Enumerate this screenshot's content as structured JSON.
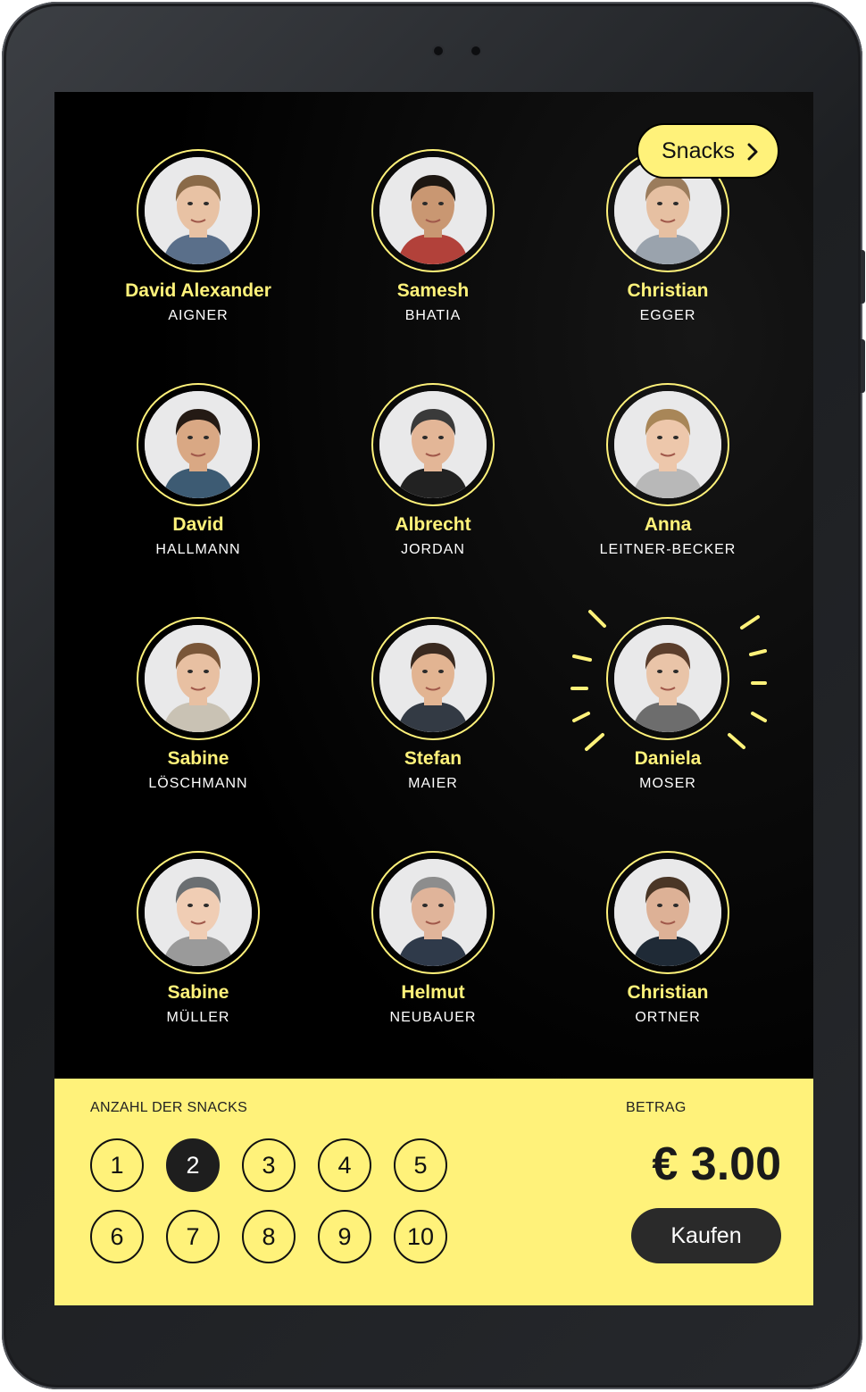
{
  "header": {
    "snacks_button_label": "Snacks"
  },
  "people": [
    {
      "first": "David Alexander",
      "last": "AIGNER",
      "selected": false
    },
    {
      "first": "Samesh",
      "last": "BHATIA",
      "selected": false
    },
    {
      "first": "Christian",
      "last": "EGGER",
      "selected": false
    },
    {
      "first": "David",
      "last": "HALLMANN",
      "selected": false
    },
    {
      "first": "Albrecht",
      "last": "JORDAN",
      "selected": false
    },
    {
      "first": "Anna",
      "last": "LEITNER-BECKER",
      "selected": false
    },
    {
      "first": "Sabine",
      "last": "LÖSCHMANN",
      "selected": false
    },
    {
      "first": "Stefan",
      "last": "MAIER",
      "selected": false
    },
    {
      "first": "Daniela",
      "last": "MOSER",
      "selected": true
    },
    {
      "first": "Sabine",
      "last": "MÜLLER",
      "selected": false
    },
    {
      "first": "Helmut",
      "last": "NEUBAUER",
      "selected": false
    },
    {
      "first": "Christian",
      "last": "ORTNER",
      "selected": false
    }
  ],
  "footer": {
    "quantity_label": "ANZAHL DER SNACKS",
    "quantities": [
      "1",
      "2",
      "3",
      "4",
      "5",
      "6",
      "7",
      "8",
      "9",
      "10"
    ],
    "selected_quantity": "2",
    "amount_label": "BETRAG",
    "amount": "€ 3.00",
    "buy_label": "Kaufen"
  },
  "colors": {
    "accent": "#fff27a",
    "screen_bg": "#000000",
    "dark_button": "#2a2a2a"
  }
}
